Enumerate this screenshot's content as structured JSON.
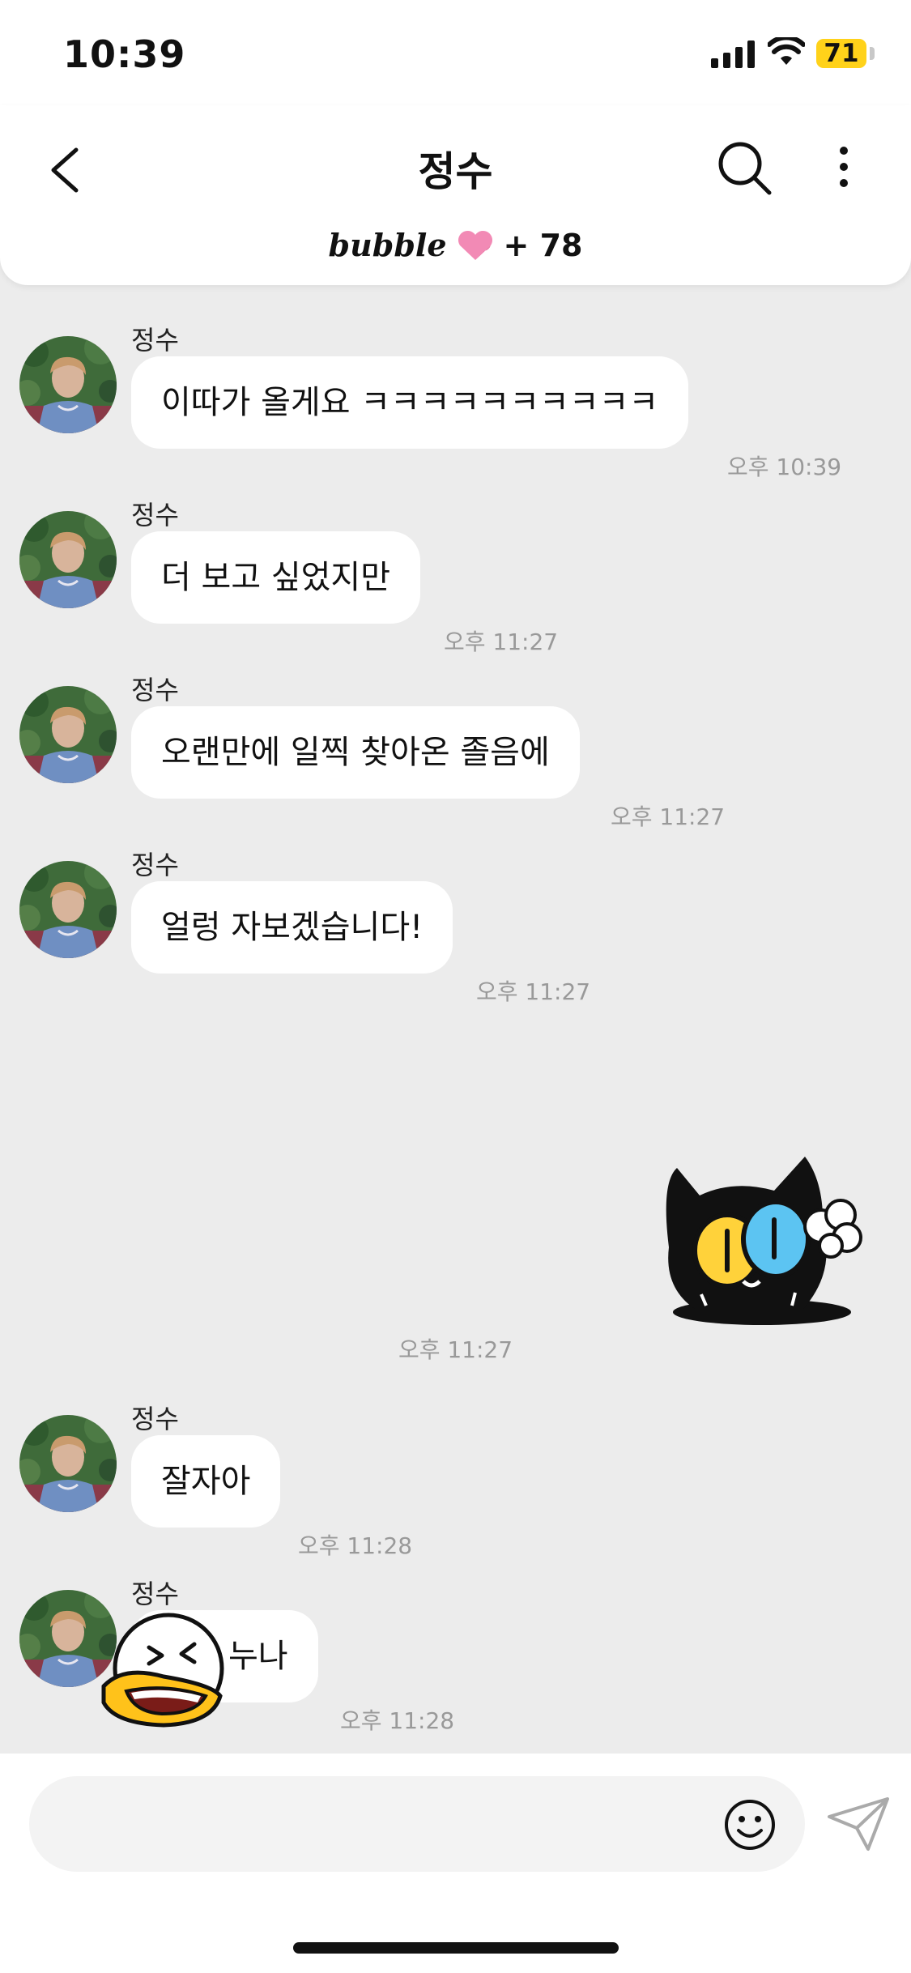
{
  "status_bar": {
    "time": "10:39",
    "battery": "71"
  },
  "header": {
    "title": "정수",
    "bubble_label": "bubble",
    "count": "+ 78"
  },
  "messages": [
    {
      "sender": "정수",
      "text": "이따가 올게요 ㅋㅋㅋㅋㅋㅋㅋㅋㅋㅋ",
      "time": "오후 10:39"
    },
    {
      "sender": "정수",
      "text": "더 보고 싶었지만",
      "time": "오후 11:27"
    },
    {
      "sender": "정수",
      "text": "오랜만에 일찍 찾아온 졸음에",
      "time": "오후 11:27"
    },
    {
      "sender": "정수",
      "text": "얼렁 자보겠습니다!",
      "time": "오후 11:27"
    },
    {
      "sender": "정수",
      "text": "잘자아",
      "time": "오후 11:28"
    },
    {
      "sender": "정수",
      "text": "누나",
      "time": "오후 11:28"
    }
  ],
  "sent_sticker": {
    "time": "오후 11:27",
    "icon": "black-cat-sticker"
  },
  "input": {
    "placeholder": ""
  },
  "icons": [
    "back-chevron-icon",
    "search-icon",
    "more-vertical-icon",
    "heart-icon",
    "emoji-icon",
    "send-icon"
  ],
  "colors": {
    "battery": "#ffd21a",
    "heart": "#f28ab5",
    "background": "#ececec"
  }
}
